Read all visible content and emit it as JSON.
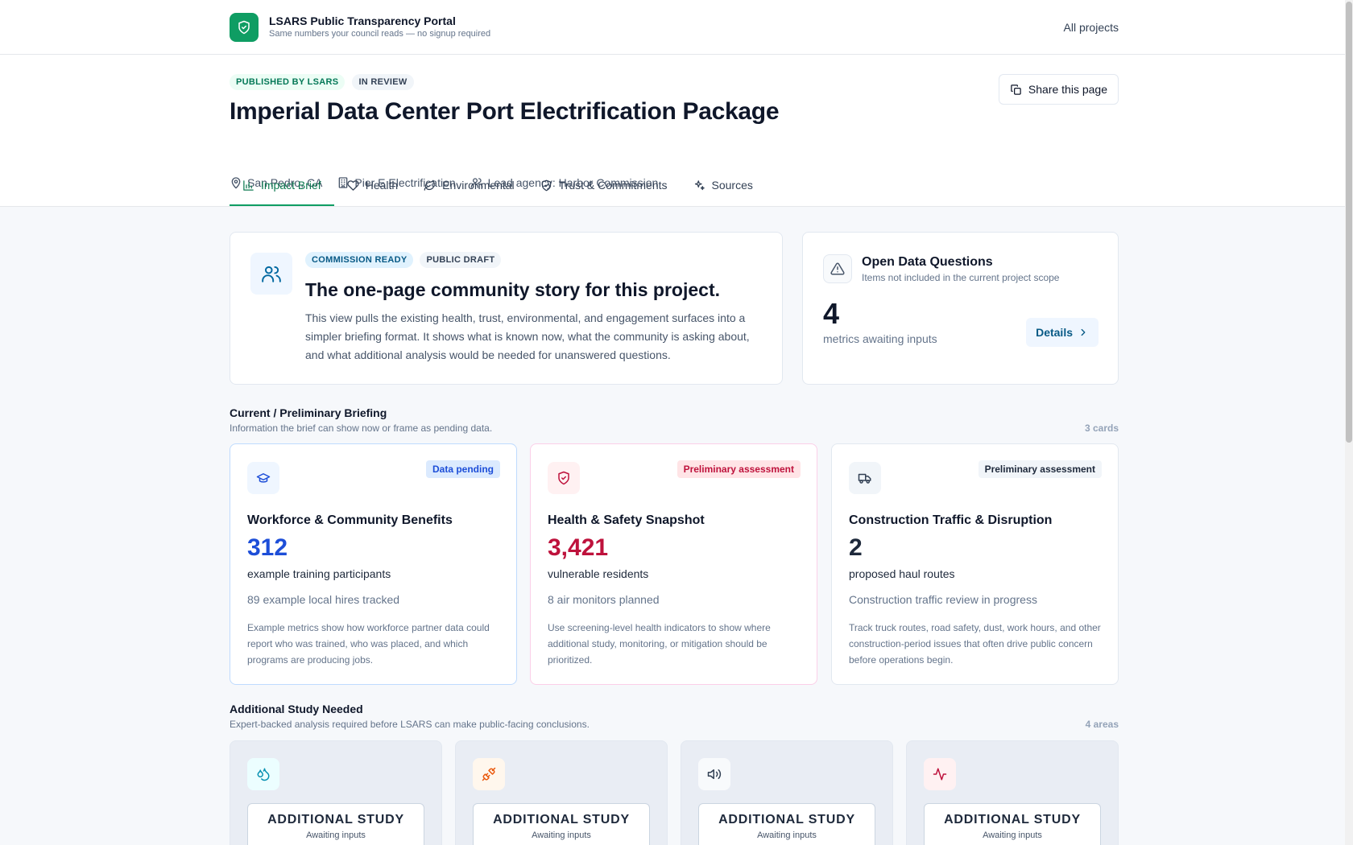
{
  "topbar": {
    "brand_title": "LSARS Public Transparency Portal",
    "brand_subtitle": "Same numbers your council reads — no signup required",
    "all_projects": "All projects"
  },
  "header": {
    "pills": [
      "PUBLISHED BY LSARS",
      "IN REVIEW"
    ],
    "title": "Imperial Data Center Port Electrification Package",
    "meta": {
      "location": "San Pedro, CA",
      "facility": "Pier E Electrification",
      "agency": "Lead agency: Harbor Commission"
    },
    "share_label": "Share this page"
  },
  "tabs": [
    {
      "label": "Impact Brief",
      "icon": "bar-chart-icon",
      "active": true
    },
    {
      "label": "Health",
      "icon": "heart-icon",
      "active": false
    },
    {
      "label": "Environmental",
      "icon": "leaf-icon",
      "active": false
    },
    {
      "label": "Trust & Commitments",
      "icon": "shield-check-icon",
      "active": false
    },
    {
      "label": "Sources",
      "icon": "sparkles-icon",
      "active": false
    }
  ],
  "hero": {
    "pills": [
      "COMMISSION READY",
      "PUBLIC DRAFT"
    ],
    "heading": "The one-page community story for this project.",
    "text": "This view pulls the existing health, trust, environmental, and engagement surfaces into a simpler briefing format. It shows what is known now, what the community is asking about, and what additional analysis would be needed for unanswered questions."
  },
  "open_questions": {
    "title": "Open Data Questions",
    "subtitle": "Items not included in the current project scope",
    "count": "4",
    "label": "metrics awaiting inputs",
    "details_label": "Details"
  },
  "briefing": {
    "title": "Current / Preliminary Briefing",
    "subtitle": "Information the brief can show now or frame as pending data.",
    "count": "3 cards",
    "cards": [
      {
        "icon": "graduation-cap-icon",
        "badge": "Data pending",
        "title": "Workforce & Community Benefits",
        "value": "312",
        "value_label": "example training participants",
        "sub": "89 example local hires tracked",
        "desc": "Example metrics show how workforce partner data could report who was trained, who was placed, and which programs are producing jobs.",
        "accent": "#1d4ed8"
      },
      {
        "icon": "shield-check-icon",
        "badge": "Preliminary assessment",
        "title": "Health & Safety Snapshot",
        "value": "3,421",
        "value_label": "vulnerable residents",
        "sub": "8 air monitors planned",
        "desc": "Use screening-level health indicators to show where additional study, monitoring, or mitigation should be prioritized.",
        "accent": "#be123c"
      },
      {
        "icon": "truck-icon",
        "badge": "Preliminary assessment",
        "title": "Construction Traffic & Disruption",
        "value": "2",
        "value_label": "proposed haul routes",
        "sub": "Construction traffic review in progress",
        "desc": "Track truck routes, road safety, dust, work hours, and other construction-period issues that often drive public concern before operations begin.",
        "accent": "#1e293b"
      }
    ]
  },
  "study": {
    "title": "Additional Study Needed",
    "subtitle": "Expert-backed analysis required before LSARS can make public-facing conclusions.",
    "count": "4 areas",
    "cards": [
      {
        "icon": "droplets-icon",
        "big": "ADDITIONAL STUDY",
        "small": "Awaiting inputs"
      },
      {
        "icon": "plug-icon",
        "big": "ADDITIONAL STUDY",
        "small": "Awaiting inputs"
      },
      {
        "icon": "speaker-icon",
        "big": "ADDITIONAL STUDY",
        "small": "Awaiting inputs"
      },
      {
        "icon": "activity-icon",
        "big": "ADDITIONAL STUDY",
        "small": "Awaiting inputs"
      }
    ]
  },
  "colors": {
    "brand": "#0f9d63",
    "active_tab": "#0f7a52",
    "workforce": "#1d4ed8",
    "health": "#be123c"
  }
}
